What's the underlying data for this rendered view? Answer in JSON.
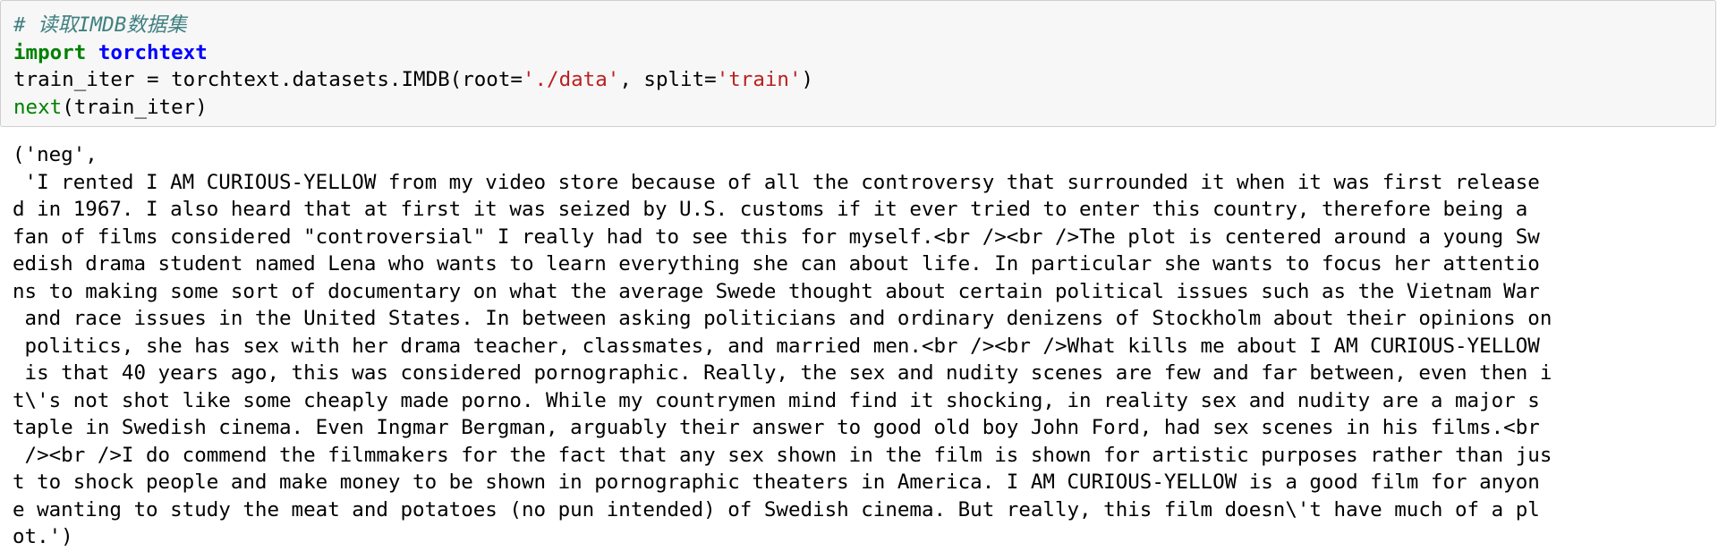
{
  "code_cell": {
    "comment": "# 读取IMDB数据集",
    "line2": {
      "keyword": "import",
      "module": "torchtext"
    },
    "line3": {
      "prefix": "train_iter = torchtext.datasets.IMDB(root=",
      "str1": "'./data'",
      "middle": ", split=",
      "str2": "'train'",
      "suffix": ")"
    },
    "line4": {
      "builtin": "next",
      "args": "(train_iter)"
    }
  },
  "output_cell": {
    "lines": [
      "('neg',",
      " 'I rented I AM CURIOUS-YELLOW from my video store because of all the controversy that surrounded it when it was first release",
      "d in 1967. I also heard that at first it was seized by U.S. customs if it ever tried to enter this country, therefore being a ",
      "fan of films considered \"controversial\" I really had to see this for myself.<br /><br />The plot is centered around a young Sw",
      "edish drama student named Lena who wants to learn everything she can about life. In particular she wants to focus her attentio",
      "ns to making some sort of documentary on what the average Swede thought about certain political issues such as the Vietnam War",
      " and race issues in the United States. In between asking politicians and ordinary denizens of Stockholm about their opinions on",
      " politics, she has sex with her drama teacher, classmates, and married men.<br /><br />What kills me about I AM CURIOUS-YELLOW",
      " is that 40 years ago, this was considered pornographic. Really, the sex and nudity scenes are few and far between, even then i",
      "t\\'s not shot like some cheaply made porno. While my countrymen mind find it shocking, in reality sex and nudity are a major s",
      "taple in Swedish cinema. Even Ingmar Bergman, arguably their answer to good old boy John Ford, had sex scenes in his films.<br",
      " /><br />I do commend the filmmakers for the fact that any sex shown in the film is shown for artistic purposes rather than jus",
      "t to shock people and make money to be shown in pornographic theaters in America. I AM CURIOUS-YELLOW is a good film for anyon",
      "e wanting to study the meat and potatoes (no pun intended) of Swedish cinema. But really, this film doesn\\'t have much of a pl",
      "ot.')"
    ]
  }
}
